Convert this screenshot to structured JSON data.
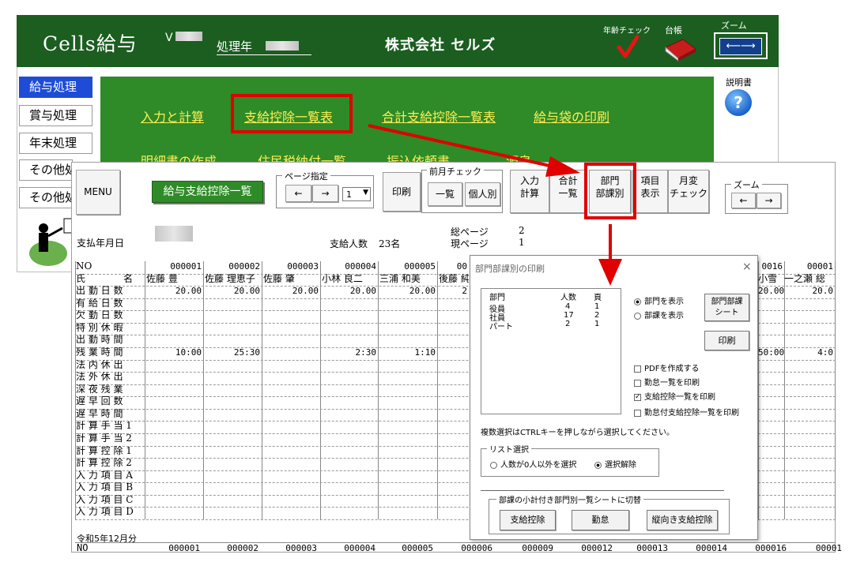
{
  "back": {
    "app_title": "Cells給与",
    "version_label": "V",
    "proc_year_label": "処理年",
    "company_name": "株式会社 セルズ",
    "age_check_label": "年齢チェック",
    "ledger_label": "台帳",
    "zoom_label": "ズーム",
    "help_label": "説明書",
    "sidebar": [
      "給与処理",
      "賞与処理",
      "年末処理",
      "その他処理",
      "その他処理"
    ],
    "menu_row1": [
      "入力と計算",
      "支給控除一覧表",
      "合計支給控除一覧表",
      "給与袋の印刷"
    ],
    "menu_row2": [
      "明細書の作成",
      "住民税納付一覧",
      "振込依頼書",
      "源泉"
    ]
  },
  "front": {
    "menu_button": "MENU",
    "title_button": "給与支給控除一覧",
    "page_group_label": "ページ指定",
    "page_value": "1",
    "print_button": "印刷",
    "prev_month_group_label": "前月チェック",
    "list_button": "一覧",
    "individual_button": "個人別",
    "input_calc_button": [
      "入力",
      "計算"
    ],
    "total_list_button": [
      "合計",
      "一覧"
    ],
    "dept_button": [
      "部門",
      "部課別"
    ],
    "item_display_button": [
      "項目",
      "表示"
    ],
    "monthly_change_button": [
      "月変",
      "チェック"
    ],
    "zoom_group_label": "ズーム",
    "pay_date_label": "支払年月日",
    "employee_count_label": "支給人数",
    "employee_count_value": "23名",
    "total_pages_label": "総ページ",
    "total_pages_value": "2",
    "current_page_label": "現ページ",
    "current_page_value": "1",
    "footer_date": "令和5年12月分"
  },
  "table": {
    "row_labels": [
      "NO",
      "氏　　　　名",
      "出 勤 日 数",
      "有 給 日 数",
      "欠 勤 日 数",
      "特 別 休 暇",
      "出 勤 時 間",
      "残 業 時 間",
      "法 内 休 出",
      "法 外 休 出",
      "深 夜 残 業",
      "遅 早 回 数",
      "遅 早 時 間",
      "計 算 手 当 1",
      "計 算 手 当 2",
      "計 算 控 除 1",
      "計 算 控 除 2",
      "入 力 項 目 A",
      "入 力 項 目 B",
      "入 力 項 目 C",
      "入 力 項 目 D"
    ],
    "columns": [
      {
        "no": "000001",
        "name": "佐藤 豊",
        "attend": "20.00",
        "overtime": "10:00"
      },
      {
        "no": "000002",
        "name": "佐藤 理恵子",
        "attend": "20.00",
        "overtime": "25:30"
      },
      {
        "no": "000003",
        "name": "佐藤 肇",
        "attend": "20.00",
        "overtime": ""
      },
      {
        "no": "000004",
        "name": "小林 良二",
        "attend": "20.00",
        "overtime": "2:30"
      },
      {
        "no": "000005",
        "name": "三浦 和美",
        "attend": "20.00",
        "overtime": "1:10"
      },
      {
        "no": "00",
        "name": "後藤 純",
        "attend": "2",
        "overtime": ""
      }
    ],
    "right_columns": [
      {
        "no": "0016",
        "name": "小雪",
        "attend": "20.00",
        "overtime": "50:00"
      },
      {
        "no": "00001",
        "name": "一之瀬 総",
        "attend": "20.0",
        "overtime": "4:0"
      }
    ],
    "bottom_no_row": [
      "NO",
      "000001",
      "000002",
      "000003",
      "000004",
      "000005",
      "000006",
      "000009",
      "000012",
      "000013",
      "000014",
      "000016",
      "00001"
    ]
  },
  "dialog": {
    "title": "部門部課別の印刷",
    "close": "×",
    "list_headers": [
      "部門",
      "人数",
      "頁"
    ],
    "list_rows": [
      {
        "dept": "役員",
        "count": "4",
        "page": "1"
      },
      {
        "dept": "社員",
        "count": "17",
        "page": "2"
      },
      {
        "dept": "パート",
        "count": "2",
        "page": "1"
      }
    ],
    "radio_show_dept": "部門を表示",
    "radio_show_section": "部課を表示",
    "dept_sheet_button": [
      "部門部課",
      "シート"
    ],
    "print_button": "印刷",
    "chk_pdf": "PDFを作成する",
    "chk_attendance": "勤怠一覧を印刷",
    "chk_payment": "支給控除一覧を印刷",
    "chk_att_payment": "勤怠付支給控除一覧を印刷",
    "multi_select_note": "複数選択はCTRLキーを押しながら選択してください。",
    "list_select_label": "リスト選択",
    "radio_select_nonzero": "人数が0人以外を選択",
    "radio_clear": "選択解除",
    "switch_group_label": "部課の小計付き部門別一覧シートに切替",
    "btn_payment": "支給控除",
    "btn_attendance": "勤怠",
    "btn_att_payment": "縦向き支給控除"
  }
}
